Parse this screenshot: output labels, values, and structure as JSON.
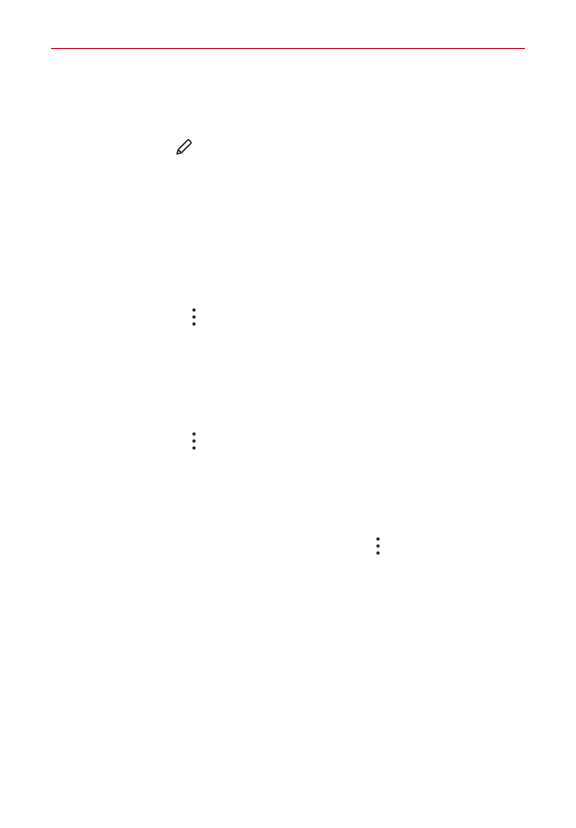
{
  "page": {
    "accent_color": "#c8102e",
    "text_color": "#222222"
  },
  "icons": [
    {
      "name": "pencil-icon"
    },
    {
      "name": "more-options-icon"
    },
    {
      "name": "more-options-icon"
    },
    {
      "name": "more-options-icon"
    }
  ]
}
